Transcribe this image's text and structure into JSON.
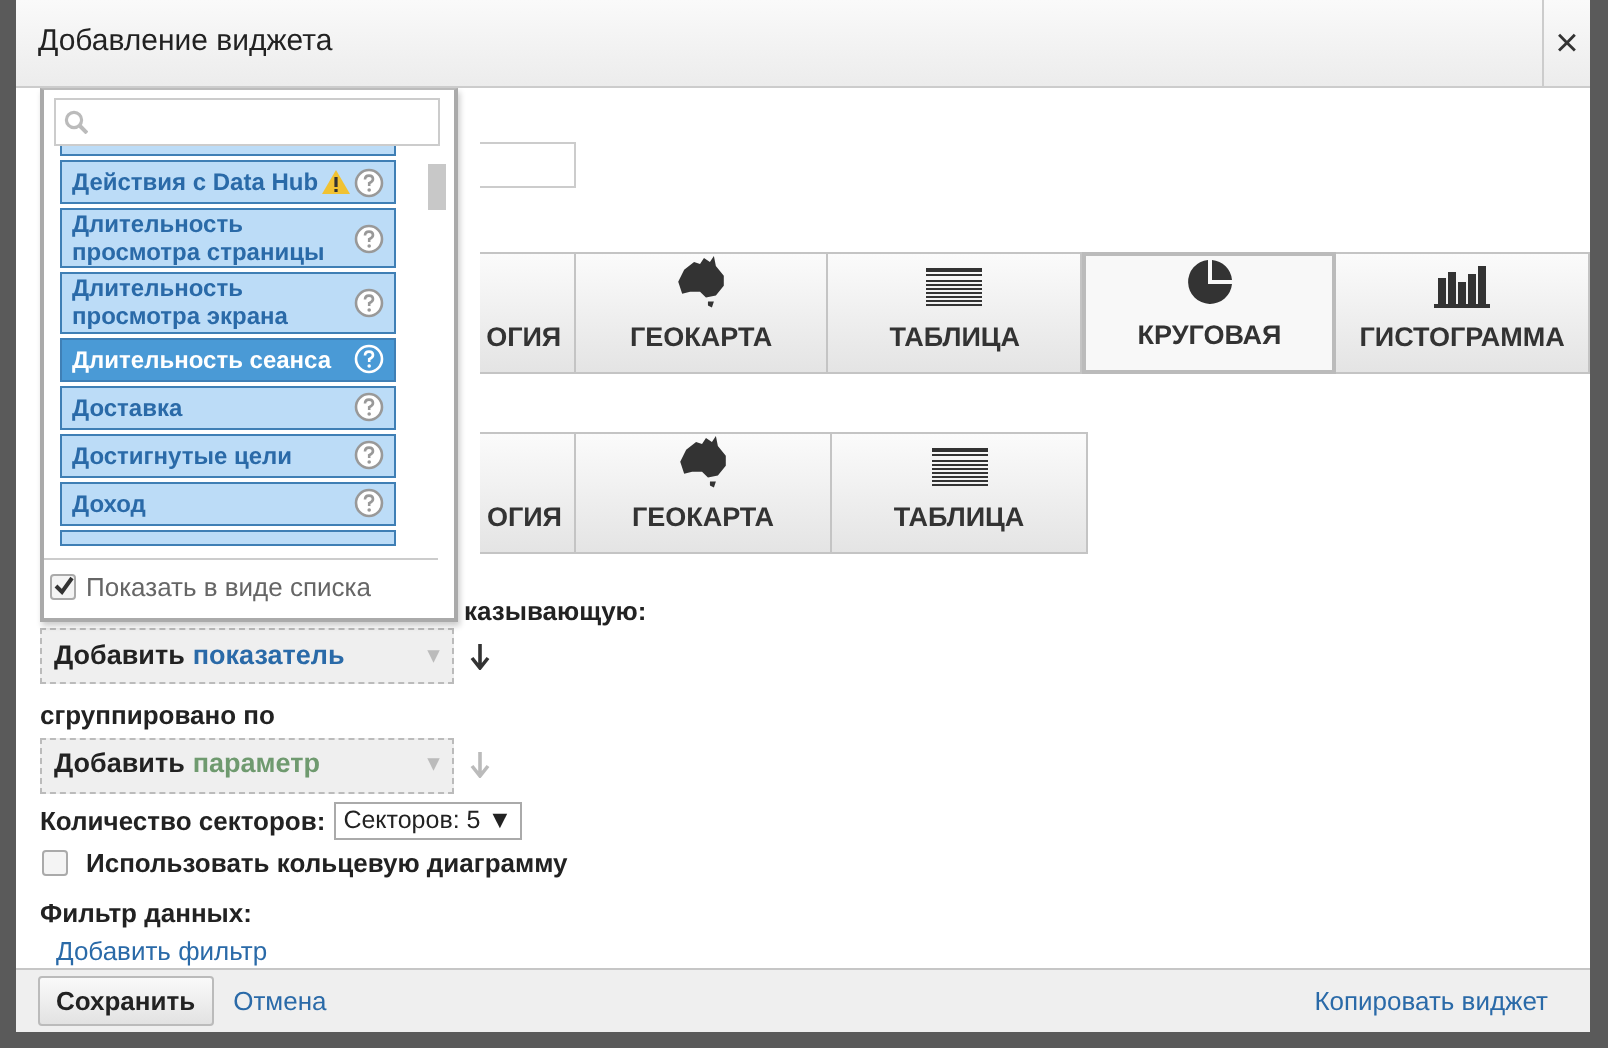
{
  "window": {
    "title": "Добавление виджета",
    "close": "×"
  },
  "chart_type_rows": [
    {
      "buttons": [
        {
          "label": "ОГИЯ",
          "selected": false
        },
        {
          "label": "ГЕОКАРТА",
          "kind": "geomap",
          "selected": false
        },
        {
          "label": "ТАБЛИЦА",
          "kind": "table",
          "selected": false
        },
        {
          "label": "КРУГОВАЯ",
          "kind": "pie",
          "selected": true
        },
        {
          "label": "ГИСТОГРАММА",
          "kind": "bar",
          "selected": false
        }
      ]
    },
    {
      "buttons": [
        {
          "label": "ОГИЯ",
          "selected": false
        },
        {
          "label": "ГЕОКАРТА",
          "kind": "geomap",
          "selected": false
        },
        {
          "label": "ТАБЛИЦА",
          "kind": "table",
          "selected": false
        }
      ]
    }
  ],
  "metric_label": "казывающую:",
  "metric_selector": {
    "prefix": "Добавить",
    "keyword": "показатель",
    "caret": "▾",
    "disabled": false
  },
  "grouped_label": "сгруппировано по",
  "dimension_selector": {
    "prefix": "Добавить",
    "keyword": "параметр",
    "caret": "▾",
    "disabled": true
  },
  "sectors": {
    "label": "Количество секторов:",
    "value": "Секторов: 5 ▼"
  },
  "donut_option": {
    "label": "Использовать кольцевую диаграмму",
    "checked": false
  },
  "filter": {
    "label": "Фильтр данных:",
    "link": "Добавить фильтр"
  },
  "dropdown": {
    "items": [
      {
        "label": "Действия с Data Hub",
        "warning": true,
        "selected": false
      },
      {
        "label": "Длительность просмотра страницы",
        "warning": false,
        "selected": false
      },
      {
        "label": "Длительность просмотра экрана",
        "warning": false,
        "selected": false
      },
      {
        "label": "Длительность сеанса",
        "warning": false,
        "selected": true
      },
      {
        "label": "Доставка",
        "warning": false,
        "selected": false
      },
      {
        "label": "Достигнутые цели",
        "warning": false,
        "selected": false
      },
      {
        "label": "Доход",
        "warning": false,
        "selected": false
      }
    ],
    "list_view": {
      "label": "Показать в виде списка",
      "checked": true
    }
  },
  "footer": {
    "save": "Сохранить",
    "cancel": "Отмена",
    "copy": "Копировать виджет"
  }
}
